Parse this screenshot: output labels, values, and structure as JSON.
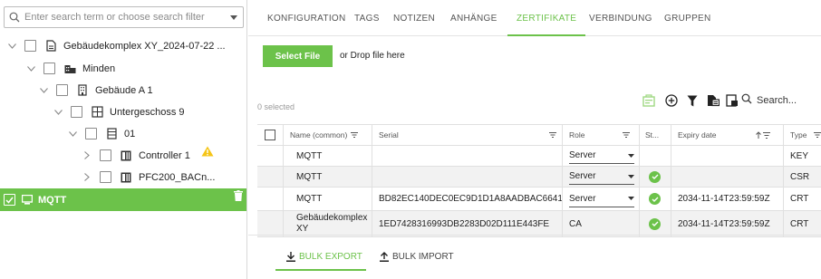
{
  "search": {
    "placeholder": "Enter search term or choose search filter"
  },
  "tree": [
    {
      "label": "Gebäudekomplex XY_2024-07-22 ...",
      "icon": "document-icon"
    },
    {
      "label": "Minden",
      "icon": "building-icon"
    },
    {
      "label": "Gebäude A 1",
      "icon": "building-icon"
    },
    {
      "label": "Untergeschoss 9",
      "icon": "floor-icon"
    },
    {
      "label": "01",
      "icon": "room-icon"
    },
    {
      "label": "Controller 1",
      "icon": "controller-icon"
    },
    {
      "label": "PFC200_BACn...",
      "icon": "controller-icon"
    },
    {
      "label": "MQTT",
      "icon": "monitor-icon"
    }
  ],
  "tabs": [
    "KONFIGURATION",
    "TAGS",
    "NOTIZEN",
    "ANHÄNGE",
    "ZERTIFIKATE",
    "VERBINDUNG",
    "GRUPPEN"
  ],
  "active_tab": "ZERTIFIKATE",
  "upload": {
    "button": "Select File",
    "drop_text": "or Drop file here"
  },
  "selection": {
    "count_text": "0 selected"
  },
  "table_search": {
    "placeholder": "Search..."
  },
  "table": {
    "headers": [
      "Name (common)",
      "Serial",
      "Role",
      "St...",
      "Expiry date",
      "Type"
    ],
    "rows": [
      {
        "name": "MQTT",
        "serial": "",
        "role": "Server",
        "status_ok": false,
        "expiry": "",
        "type": "KEY"
      },
      {
        "name": "MQTT",
        "serial": "",
        "role": "Server",
        "status_ok": true,
        "expiry": "",
        "type": "CSR"
      },
      {
        "name": "MQTT",
        "serial": "BD82EC140DEC0EC9D1D1A8AADBAC6641",
        "role": "Server",
        "status_ok": true,
        "expiry": "2034-11-14T23:59:59Z",
        "type": "CRT"
      },
      {
        "name": "Gebäudekomplex XY",
        "serial": "1ED7428316993DB2283D02D111E443FE",
        "role": "CA",
        "status_ok": true,
        "expiry": "2034-11-14T23:59:59Z",
        "type": "CRT"
      }
    ]
  },
  "bottom_tabs": {
    "export": "BULK EXPORT",
    "import": "BULK IMPORT"
  },
  "colors": {
    "accent": "#6cc24a",
    "warning": "#f5c518"
  }
}
